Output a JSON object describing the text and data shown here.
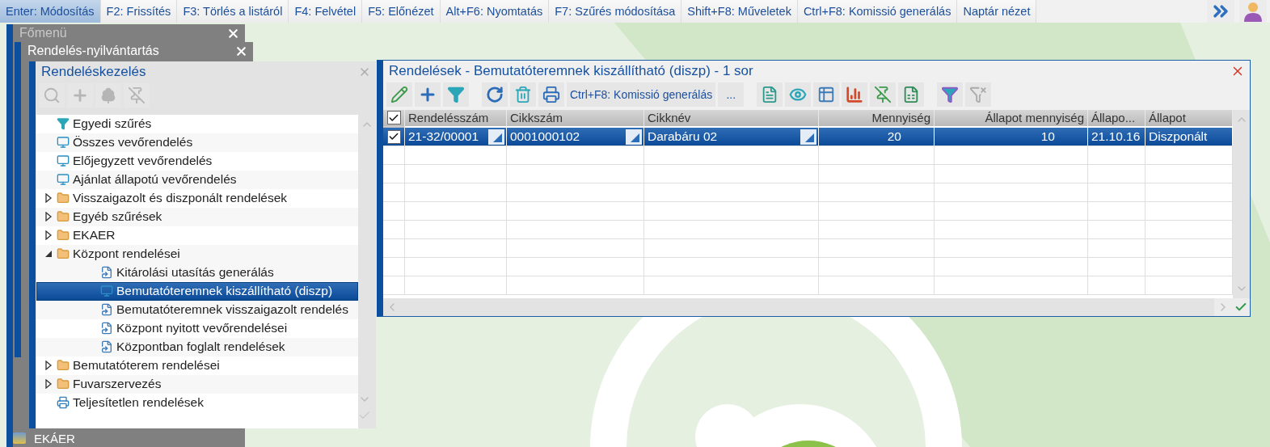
{
  "shortcut_bar": {
    "buttons": [
      {
        "label": "Enter: Módosítás",
        "selected": true
      },
      {
        "label": "F2: Frissítés",
        "selected": false
      },
      {
        "label": "F3: Törlés a listáról",
        "selected": false
      },
      {
        "label": "F4: Felvétel",
        "selected": false
      },
      {
        "label": "F5: Előnézet",
        "selected": false
      },
      {
        "label": "Alt+F6: Nyomtatás",
        "selected": false
      },
      {
        "label": "F7: Szűrés módosítása",
        "selected": false
      },
      {
        "label": "Shift+F8: Műveletek",
        "selected": false
      },
      {
        "label": "Ctrl+F8: Komissió generálás",
        "selected": false
      },
      {
        "label": "Naptár nézet",
        "selected": false
      }
    ]
  },
  "main_menu": {
    "title": "Főmenü",
    "items": [
      {
        "label": "EKÁER"
      }
    ]
  },
  "registry_window": {
    "title": "Rendelés-nyilvántartás"
  },
  "order_management": {
    "title": "Rendeléskezelés",
    "tree": [
      {
        "kind": "filter",
        "label": "Egyedi szűrés",
        "selected": false
      },
      {
        "kind": "view",
        "label": "Összes vevőrendelés",
        "selected": false
      },
      {
        "kind": "view",
        "label": "Előjegyzett vevőrendelés",
        "selected": false
      },
      {
        "kind": "view",
        "label": "Ajánlat állapotú vevőrendelés",
        "selected": false
      },
      {
        "kind": "folder",
        "label": "Visszaigazolt és diszponált rendelések",
        "selected": false,
        "expanded": false
      },
      {
        "kind": "folder",
        "label": "Egyéb szűrések",
        "selected": false,
        "expanded": false
      },
      {
        "kind": "folder",
        "label": "EKAER",
        "selected": false,
        "expanded": false
      },
      {
        "kind": "folder",
        "label": "Központ rendelései",
        "selected": false,
        "expanded": true,
        "children": [
          {
            "kind": "report",
            "label": "Kitárolási utasítás generálás",
            "selected": false
          },
          {
            "kind": "view",
            "label": "Bemutatóteremnek kiszállítható (diszp)",
            "selected": true
          },
          {
            "kind": "report",
            "label": "Bemutatóteremnek visszaigazolt rendelés",
            "selected": false
          },
          {
            "kind": "report",
            "label": "Központ nyitott vevőrendelései",
            "selected": false
          },
          {
            "kind": "report",
            "label": "Központban foglalt rendelések",
            "selected": false
          }
        ]
      },
      {
        "kind": "folder",
        "label": "Bemutatóterem rendelései",
        "selected": false,
        "expanded": false
      },
      {
        "kind": "folder",
        "label": "Fuvarszervezés",
        "selected": false,
        "expanded": false
      },
      {
        "kind": "print",
        "label": "Teljesítetlen rendelések",
        "selected": false
      }
    ]
  },
  "orders_window": {
    "title": "Rendelések - Bemutatóteremnek kiszállítható (diszp) - 1 sor",
    "toolbar_text_button": "Ctrl+F8: Komissió generálás",
    "more_button": "...",
    "table": {
      "all_checked": true,
      "columns": [
        {
          "label": "Rendelésszám",
          "kind": "lookup"
        },
        {
          "label": "Cikkszám",
          "kind": "lookup"
        },
        {
          "label": "Cikknév",
          "kind": "lookup"
        },
        {
          "label": "Mennyiség",
          "kind": "number"
        },
        {
          "label": "Állapot mennyiség",
          "kind": "number"
        },
        {
          "label": "Állapo...",
          "kind": "text"
        },
        {
          "label": "Állapot",
          "kind": "text"
        }
      ],
      "rows": [
        {
          "selected": true,
          "checked": true,
          "cells": [
            "21-32/00001",
            "0001000102",
            "Darabáru 02",
            "20",
            "10",
            "21.10.16",
            "Diszponált"
          ]
        }
      ]
    }
  }
}
